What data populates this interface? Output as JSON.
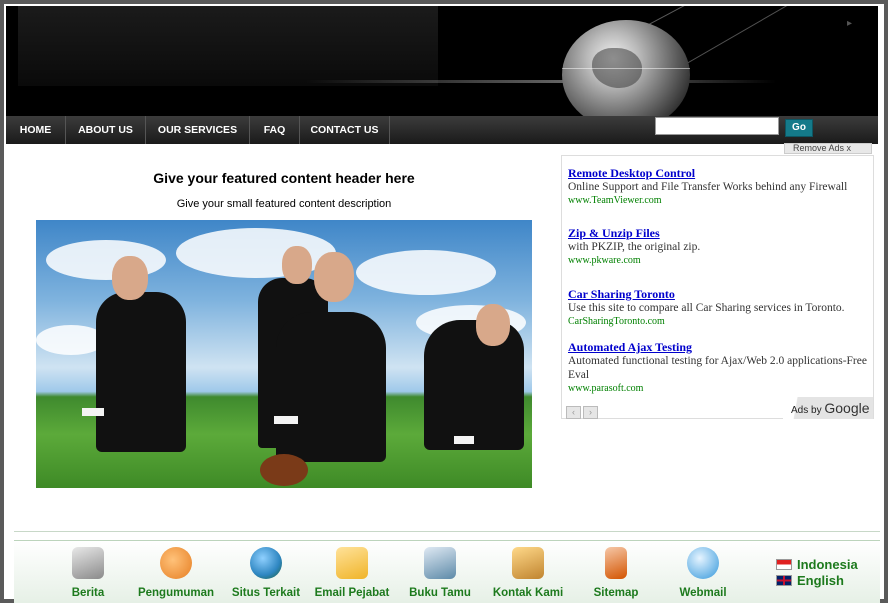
{
  "nav": {
    "items": [
      {
        "label": "HOME"
      },
      {
        "label": "ABOUT US"
      },
      {
        "label": "OUR SERVICES"
      },
      {
        "label": "FAQ"
      },
      {
        "label": "CONTACT US"
      }
    ]
  },
  "search": {
    "value": "",
    "placeholder": "",
    "button_label": "Go"
  },
  "featured": {
    "title": "Give your featured content header here",
    "description": "Give your small featured content description"
  },
  "ads": {
    "remove_label": "Remove Ads x",
    "items": [
      {
        "title": "Remote Desktop Control",
        "text": "Online Support and File Transfer Works behind any Firewall",
        "url": "www.TeamViewer.com"
      },
      {
        "title": "Zip & Unzip Files",
        "text": "with PKZIP, the original zip.",
        "url": "www.pkware.com"
      },
      {
        "title": "Car Sharing Toronto",
        "text": "Use this site to compare all Car Sharing services in Toronto.",
        "url": "CarSharingToronto.com"
      },
      {
        "title": "Automated Ajax Testing",
        "text": "Automated functional testing for Ajax/Web 2.0 applications-Free Eval",
        "url": "www.parasoft.com"
      }
    ],
    "ads_by": "Ads by",
    "google": "Google"
  },
  "footer": {
    "items": [
      {
        "label": "Berita",
        "icon": "newspaper-icon",
        "color": "#8a8a8a"
      },
      {
        "label": "Pengumuman",
        "icon": "announcement-icon",
        "color": "#e67e22"
      },
      {
        "label": "Situs Terkait",
        "icon": "globe-icon",
        "color": "#2e86c1"
      },
      {
        "label": "Email Pejabat",
        "icon": "email-icon",
        "color": "#f0b429"
      },
      {
        "label": "Buku Tamu",
        "icon": "guestbook-icon",
        "color": "#5d8aa8"
      },
      {
        "label": "Kontak Kami",
        "icon": "contact-icon",
        "color": "#c0842f"
      },
      {
        "label": "Sitemap",
        "icon": "sitemap-icon",
        "color": "#d35400"
      },
      {
        "label": "Webmail",
        "icon": "webmail-icon",
        "color": "#3498db"
      }
    ],
    "languages": [
      {
        "label": "Indonesia"
      },
      {
        "label": "English"
      }
    ]
  }
}
